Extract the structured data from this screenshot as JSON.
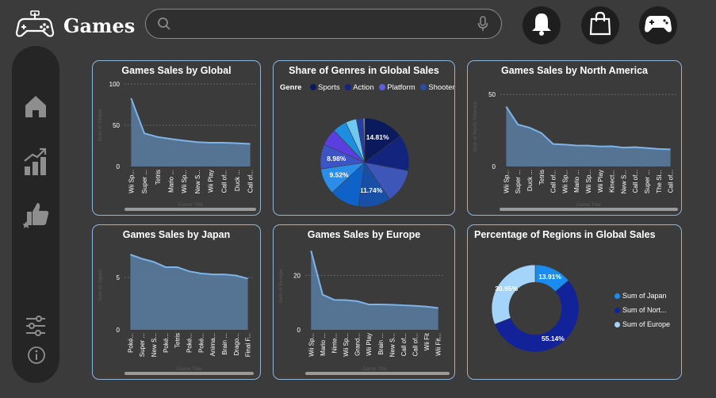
{
  "app": {
    "title": "Games"
  },
  "search": {
    "placeholder": ""
  },
  "header_icons": [
    "bell-icon",
    "shopping-bag-icon",
    "gamepad-icon"
  ],
  "sidebar": {
    "icons": [
      "home-icon",
      "growth-chart-icon",
      "thumbs-up-icon",
      "settings-sliders-icon",
      "info-icon"
    ]
  },
  "colors": {
    "area": "#5b7fa3",
    "line": "#7db4ea",
    "card_border": "#8fb6d8",
    "background": "#3b3b3b"
  },
  "chart_data": [
    {
      "id": "global",
      "type": "area",
      "title": "Games Sales by Global",
      "xlabel": "Game Title",
      "ylabel": "Sum of Global",
      "categories": [
        "Wii Sp...",
        "Super ...",
        "Tetris",
        "Mario ...",
        "Wii Sp...",
        "New S...",
        "Wii Play",
        "Call of...",
        "Duck ...",
        "Call of..."
      ],
      "values": [
        82.7,
        40.2,
        35.8,
        33.4,
        31.4,
        29.6,
        28.9,
        28.9,
        28.3,
        27.4
      ],
      "yticks": [
        0,
        50,
        100
      ],
      "ylim": [
        0,
        100
      ]
    },
    {
      "id": "genres",
      "type": "pie",
      "title": "Share of Genres in Global Sales",
      "legend_title": "Genre",
      "legend": [
        {
          "name": "Sports",
          "color": "#0a1a5c"
        },
        {
          "name": "Action",
          "color": "#12247e"
        },
        {
          "name": "Platform",
          "color": "#5a5ee0"
        },
        {
          "name": "Shooter",
          "color": "#2a4ea5"
        }
      ],
      "slices": [
        {
          "value": 14.81,
          "label": "14.81%",
          "color": "#0a1a5c"
        },
        {
          "value": 13.2,
          "label": "",
          "color": "#12247e"
        },
        {
          "value": 12.5,
          "label": "",
          "color": "#3e56b8"
        },
        {
          "value": 11.74,
          "label": "11.74%",
          "color": "#1850a8"
        },
        {
          "value": 10.9,
          "label": "",
          "color": "#0f62c8"
        },
        {
          "value": 9.52,
          "label": "9.52%",
          "color": "#2a8ee8"
        },
        {
          "value": 8.98,
          "label": "8.98%",
          "color": "#3d55c4"
        },
        {
          "value": 6.2,
          "label": "",
          "color": "#5a3ee0"
        },
        {
          "value": 5.1,
          "label": "",
          "color": "#1d8fe0"
        },
        {
          "value": 4.0,
          "label": "",
          "color": "#6ec8f2"
        },
        {
          "value": 2.5,
          "label": "",
          "color": "#283ca8"
        },
        {
          "value": 0.55,
          "label": "",
          "color": "#8a9ae8"
        }
      ]
    },
    {
      "id": "na",
      "type": "area",
      "title": "Games Sales by North America",
      "xlabel": "Game Title",
      "ylabel": "Sum of North America",
      "categories": [
        "Wii Sp...",
        "Super ...",
        "Duck ...",
        "Tetris",
        "Call of...",
        "Wii Sp...",
        "Mario ...",
        "Wii Sp...",
        "Wii Play",
        "Kinect...",
        "New S...",
        "Call of...",
        "Super ...",
        "The Si...",
        "Call of..."
      ],
      "values": [
        41.5,
        29.1,
        26.9,
        23.2,
        15.6,
        15.2,
        14.6,
        14.5,
        13.9,
        14.0,
        13.1,
        13.4,
        12.8,
        12.2,
        11.9
      ],
      "yticks": [
        0,
        50
      ],
      "ylim": [
        0,
        55
      ]
    },
    {
      "id": "japan",
      "type": "area",
      "title": "Games Sales by Japan",
      "xlabel": "Game Title",
      "ylabel": "Sum of Japan",
      "categories": [
        "Poké...",
        "Super ...",
        "New S...",
        "Poké...",
        "Tetris",
        "Poké...",
        "Poké...",
        "Anima...",
        "Brain ...",
        "Drago...",
        "Final F..."
      ],
      "values": [
        7.2,
        6.8,
        6.5,
        6.0,
        6.0,
        5.6,
        5.4,
        5.3,
        5.3,
        5.2,
        4.9
      ],
      "yticks": [
        0,
        5
      ],
      "ylim": [
        0,
        8.5
      ]
    },
    {
      "id": "europe",
      "type": "area",
      "title": "Games Sales by Europe",
      "xlabel": "Game Title",
      "ylabel": "Sum of Europe",
      "categories": [
        "Wii Sp...",
        "Mario ...",
        "Ninte...",
        "Wii Sp...",
        "Grand...",
        "Wii Play",
        "Brain ...",
        "New S...",
        "Call of...",
        "Call of...",
        "Wii Fit",
        "Wii Fit..."
      ],
      "values": [
        29.0,
        12.9,
        11.0,
        10.9,
        10.5,
        9.3,
        9.3,
        9.2,
        9.0,
        8.8,
        8.5,
        8.0
      ],
      "yticks": [
        0,
        20
      ],
      "ylim": [
        0,
        32
      ]
    },
    {
      "id": "regions",
      "type": "pie",
      "title": "Percentage of Regions in Global Sales",
      "donut": true,
      "slices": [
        {
          "name": "Sum of Japan",
          "value": 13.91,
          "label": "13.91%",
          "color": "#1a8cf0"
        },
        {
          "name": "Sum of Nort...",
          "value": 55.14,
          "label": "55.14%",
          "color": "#12239a"
        },
        {
          "name": "Sum of Europe",
          "value": 30.95,
          "label": "30.95%",
          "color": "#a5d4fb"
        }
      ]
    }
  ]
}
